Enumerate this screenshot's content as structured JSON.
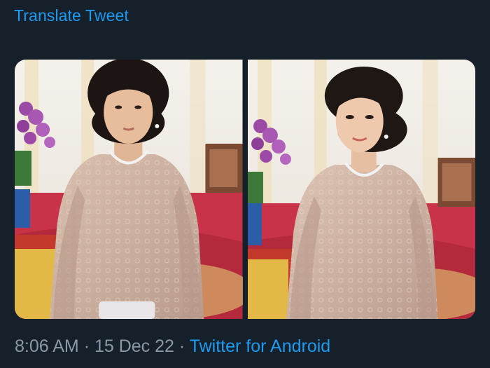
{
  "tweet": {
    "translate_label": "Translate Tweet",
    "time": "8:06 AM",
    "date": "15 Dec 22",
    "separator": "·",
    "source": "Twitter for Android"
  },
  "media": {
    "photos": [
      {
        "name": "photo-left"
      },
      {
        "name": "photo-right"
      }
    ]
  },
  "colors": {
    "background": "#15202b",
    "link": "#1d9bf0",
    "muted_text": "#8b98a5"
  }
}
